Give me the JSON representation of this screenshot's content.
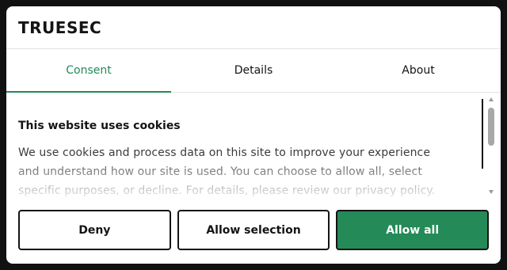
{
  "header": {
    "logo_text": "TRUESEC"
  },
  "tabs": [
    {
      "label": "Consent",
      "active": true
    },
    {
      "label": "Details",
      "active": false
    },
    {
      "label": "About",
      "active": false
    }
  ],
  "content": {
    "title": "This website uses cookies",
    "body": "We use cookies and process data on this site to improve your experience and understand how our site is used. You can choose to allow all, select specific purposes, or decline. For details, please review our privacy policy."
  },
  "buttons": {
    "deny_label": "Deny",
    "selection_label": "Allow selection",
    "allow_all_label": "Allow all"
  },
  "colors": {
    "accent": "#238a58",
    "text": "#141414",
    "backdrop": "#111111"
  }
}
